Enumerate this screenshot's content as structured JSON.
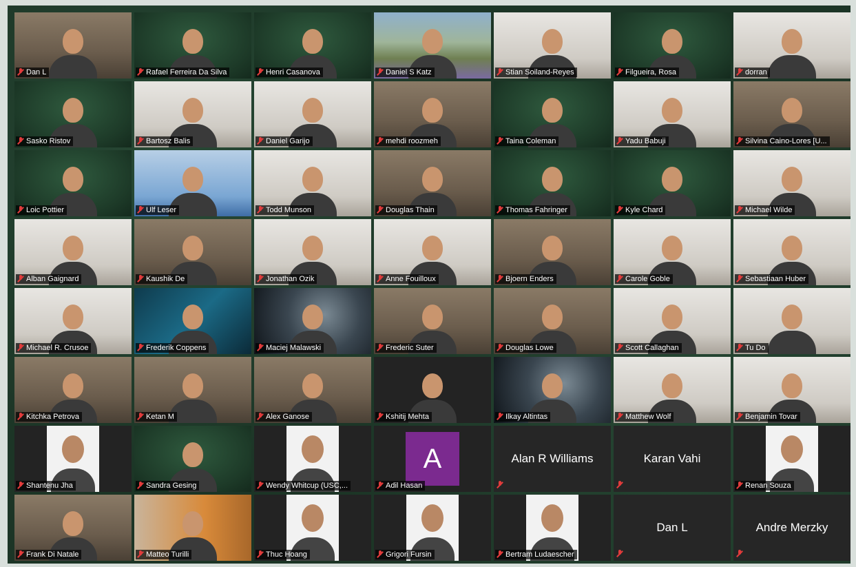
{
  "gallery": {
    "tiles": [
      {
        "name": "Dan L",
        "scene": "room"
      },
      {
        "name": "Rafael Ferreira Da Silva",
        "scene": "green"
      },
      {
        "name": "Henri Casanova",
        "scene": "green"
      },
      {
        "name": "Daniel S Katz",
        "scene": "mountain"
      },
      {
        "name": "Stian Soiland-Reyes",
        "scene": "light"
      },
      {
        "name": "Filgueira, Rosa",
        "scene": "green",
        "speaking": true
      },
      {
        "name": "dorran",
        "scene": "light"
      },
      {
        "name": "Sasko Ristov",
        "scene": "green"
      },
      {
        "name": "Bartosz Balis",
        "scene": "light"
      },
      {
        "name": "Daniel Garijo",
        "scene": "light"
      },
      {
        "name": "mehdi roozmeh",
        "scene": "room"
      },
      {
        "name": "Taina Coleman",
        "scene": "green"
      },
      {
        "name": "Yadu Babuji",
        "scene": "light"
      },
      {
        "name": "Silvina Caino-Lores [U...",
        "scene": "room"
      },
      {
        "name": "Loic Pottier",
        "scene": "green"
      },
      {
        "name": "Ulf Leser",
        "scene": "blue"
      },
      {
        "name": "Todd Munson",
        "scene": "light"
      },
      {
        "name": "Douglas Thain",
        "scene": "room"
      },
      {
        "name": "Thomas Fahringer",
        "scene": "green"
      },
      {
        "name": "Kyle Chard",
        "scene": "green"
      },
      {
        "name": "Michael Wilde",
        "scene": "light"
      },
      {
        "name": "Alban Gaignard",
        "scene": "light"
      },
      {
        "name": "Kaushik De",
        "scene": "room"
      },
      {
        "name": "Jonathan Ozik",
        "scene": "light"
      },
      {
        "name": "Anne Fouilloux",
        "scene": "light"
      },
      {
        "name": "Bjoern Enders",
        "scene": "room"
      },
      {
        "name": "Carole Goble",
        "scene": "light"
      },
      {
        "name": "Sebastiaan Huber",
        "scene": "light"
      },
      {
        "name": "Michael R. Crusoe",
        "scene": "light"
      },
      {
        "name": "Frederik Coppens",
        "scene": "teal"
      },
      {
        "name": "Maciej Malawski",
        "scene": "night"
      },
      {
        "name": "Frederic Suter",
        "scene": "room"
      },
      {
        "name": "Douglas Lowe",
        "scene": "room"
      },
      {
        "name": "Scott Callaghan",
        "scene": "light"
      },
      {
        "name": "Tu Do",
        "scene": "light"
      },
      {
        "name": "Kitchka Petrova",
        "scene": "room"
      },
      {
        "name": "Ketan M",
        "scene": "room"
      },
      {
        "name": "Alex Ganose",
        "scene": "room"
      },
      {
        "name": "Kshitij Mehta",
        "scene": "dark"
      },
      {
        "name": "Ilkay Altintas",
        "scene": "night"
      },
      {
        "name": "Matthew Wolf",
        "scene": "light"
      },
      {
        "name": "Benjamin Tovar",
        "scene": "light"
      },
      {
        "name": "Shantenu Jha",
        "scene": "photo"
      },
      {
        "name": "Sandra Gesing",
        "scene": "green"
      },
      {
        "name": "Wendy Whitcup (USC,...",
        "scene": "photo"
      },
      {
        "name": "Adil Hasan",
        "scene": "avatar",
        "initial": "A"
      },
      {
        "name": "Alan R Williams",
        "scene": "nameonly"
      },
      {
        "name": "Karan Vahi",
        "scene": "nameonly"
      },
      {
        "name": "Renan Souza",
        "scene": "photo"
      },
      {
        "name": "Frank Di Natale",
        "scene": "room"
      },
      {
        "name": "Matteo Turilli",
        "scene": "orange"
      },
      {
        "name": "Thuc Hoang",
        "scene": "photo"
      },
      {
        "name": "Grigori Fursin",
        "scene": "photo"
      },
      {
        "name": "Bertram Ludaescher",
        "scene": "photo"
      },
      {
        "name": "Dan L",
        "scene": "nameonly"
      },
      {
        "name": "Andre Merzky",
        "scene": "nameonly"
      }
    ]
  }
}
